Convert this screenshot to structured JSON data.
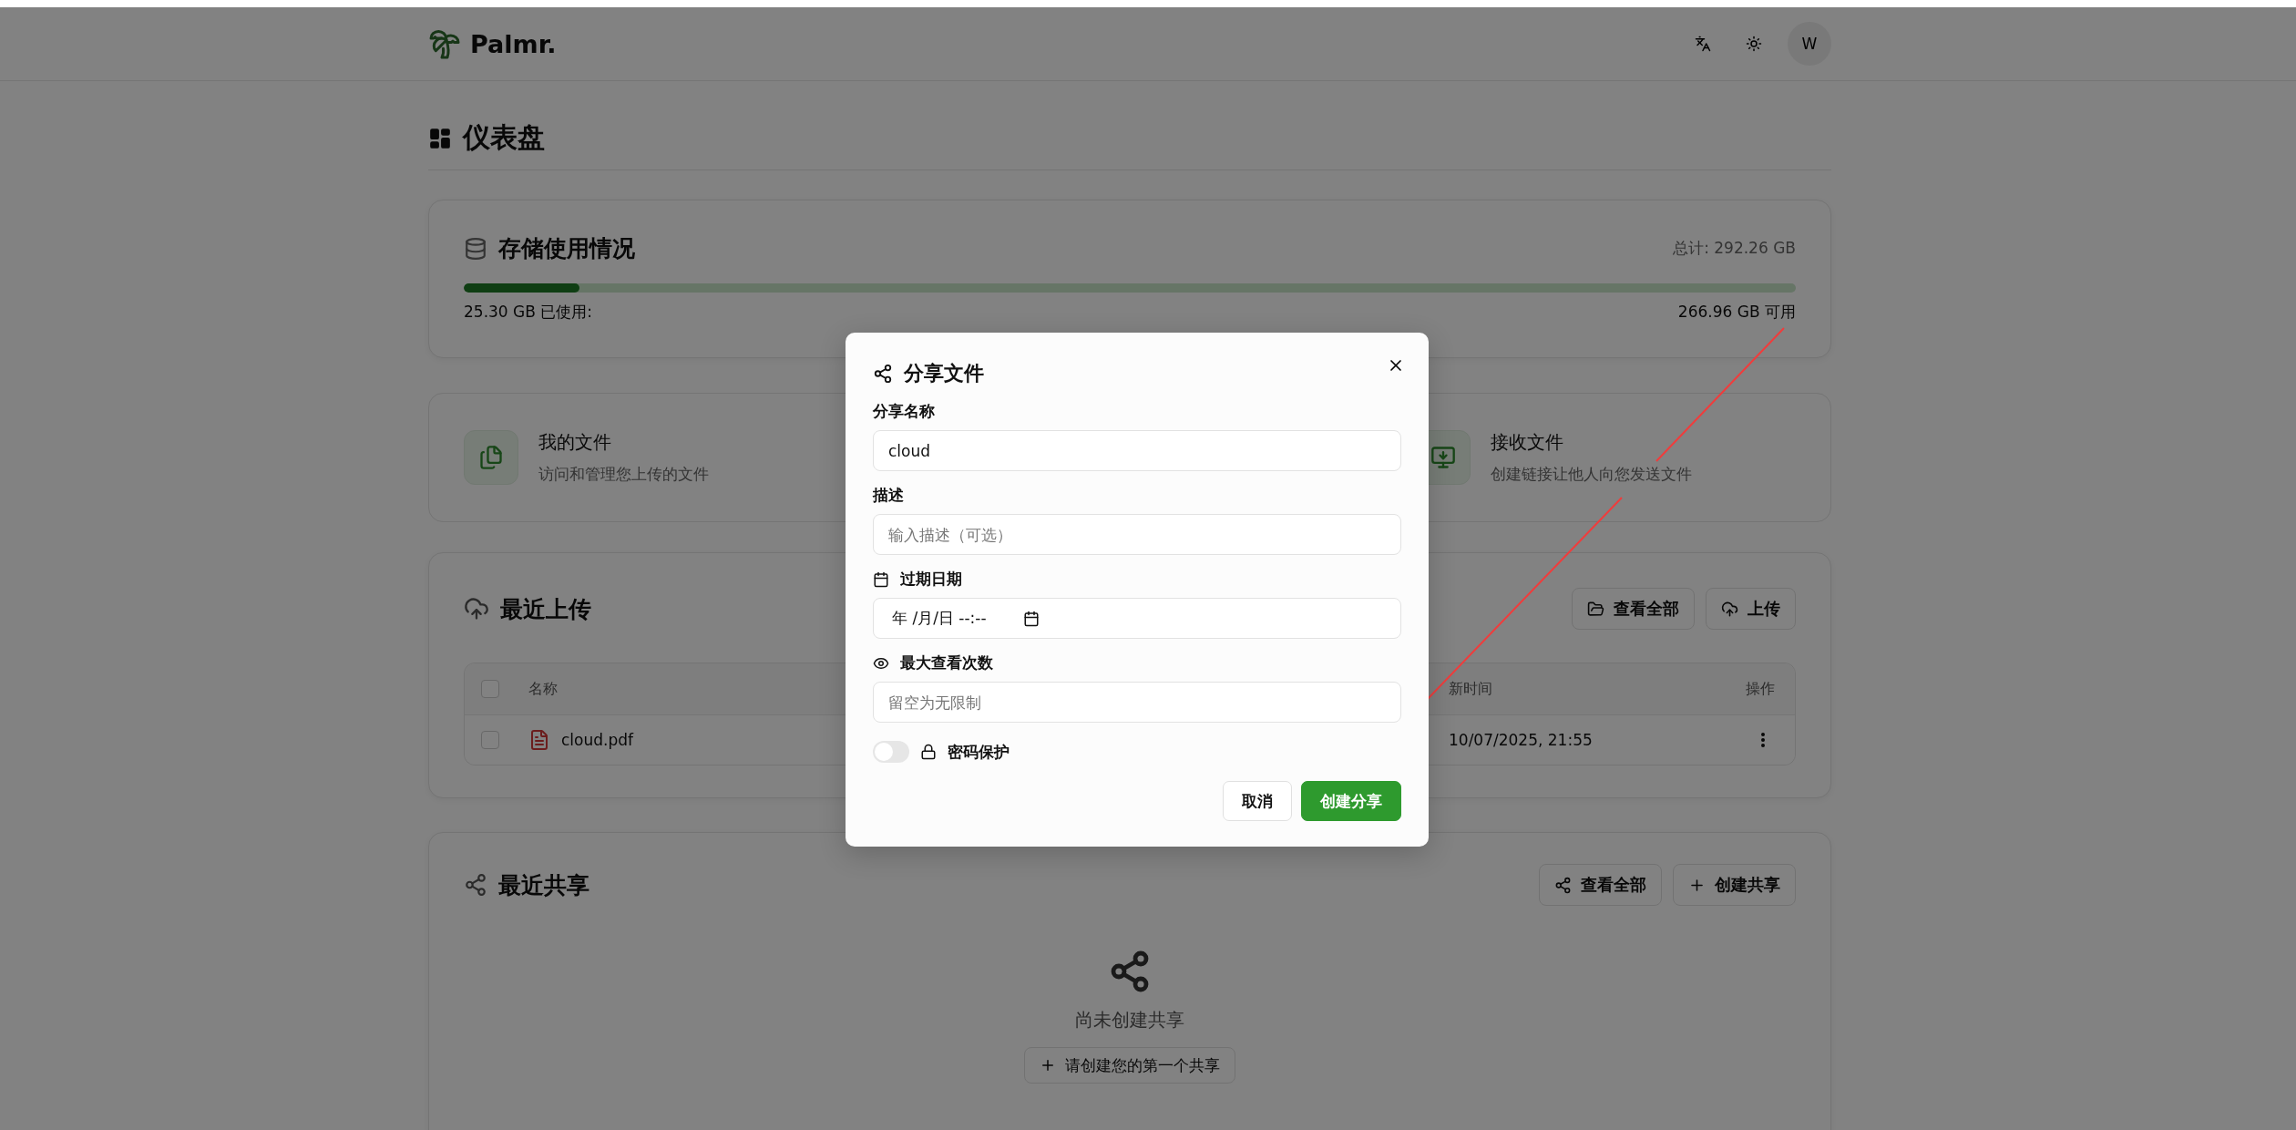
{
  "header": {
    "logo": "Palmr.",
    "avatar": "W"
  },
  "page_title": "仪表盘",
  "storage": {
    "title": "存储使用情况",
    "total": "总计: 292.26 GB",
    "level": 0.0866,
    "used": "25.30 GB 已使用:",
    "available": "266.96 GB 可用"
  },
  "quick_access": [
    {
      "title": "我的文件",
      "description": "访问和管理您上传的文件",
      "kind": "files"
    },
    {
      "title": "接收文件",
      "description": "创建链接让他人向您发送文件",
      "kind": "receive"
    }
  ],
  "recent_uploads": {
    "title": "最近上传",
    "buttons": [
      {
        "label": "查看全部",
        "kind": "folder"
      },
      {
        "label": "上传",
        "kind": "upload"
      }
    ],
    "columns": [
      "名称",
      "新时间",
      "操作"
    ],
    "header_checked": false,
    "rows": [
      {
        "name": "cloud.pdf",
        "updated": "10/07/2025, 21:55",
        "checked": false
      }
    ]
  },
  "recent_shares": {
    "title": "最近共享",
    "buttons": [
      {
        "label": "查看全部",
        "kind": "share"
      },
      {
        "label": "创建共享",
        "kind": "plus"
      }
    ],
    "empty_text": "尚未创建共享",
    "empty_button": "请创建您的第一个共享"
  },
  "dialog": {
    "title": "分享文件",
    "fields": [
      {
        "label": "分享名称",
        "value": "cloud",
        "kind": "text"
      },
      {
        "label": "描述",
        "placeholder": "输入描述（可选）",
        "kind": "text"
      },
      {
        "label": "过期日期",
        "value": "年 /月/日 --:--",
        "kind": "date"
      },
      {
        "label": "最大查看次数",
        "placeholder": "留空为无限制",
        "kind": "views"
      }
    ],
    "password": {
      "label": "密码保护",
      "on": false
    },
    "buttons": [
      {
        "label": "取消",
        "kind": "secondary"
      },
      {
        "label": "创建分享",
        "kind": "primary"
      }
    ]
  }
}
